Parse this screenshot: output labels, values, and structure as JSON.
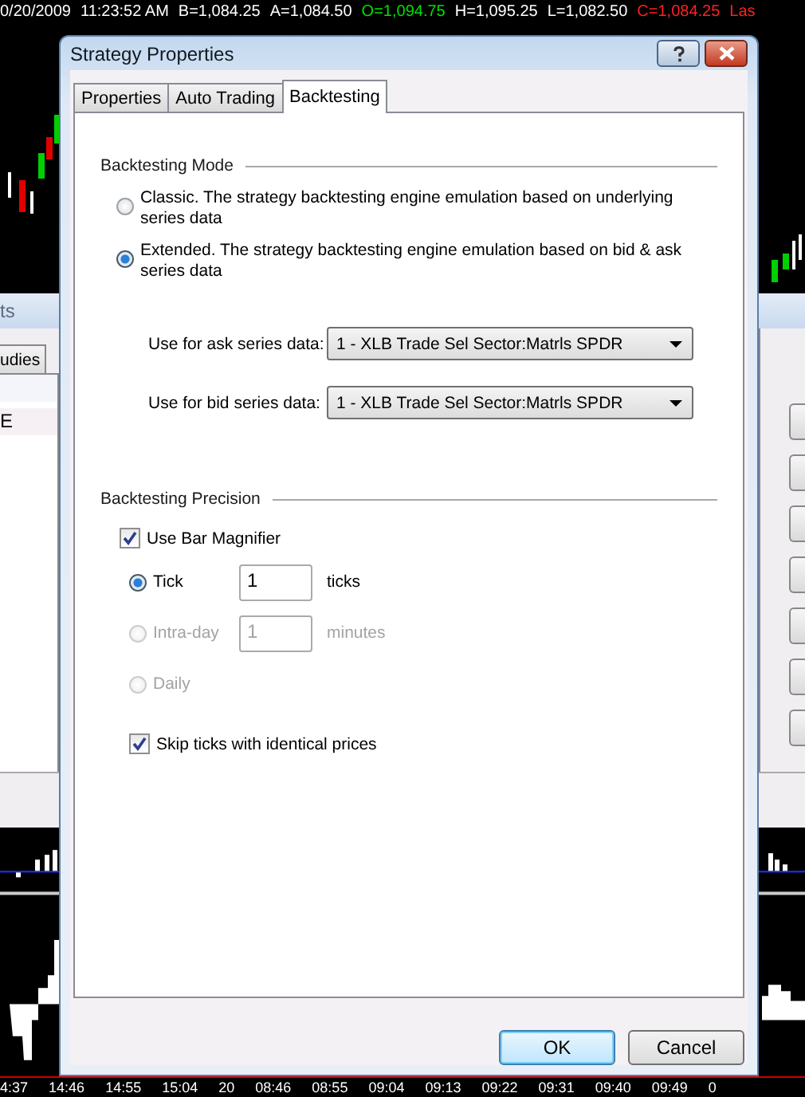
{
  "quote_bar": [
    {
      "text": "0/20/2009",
      "color": "#ffffff"
    },
    {
      "text": "11:23:52 AM",
      "color": "#ffffff"
    },
    {
      "text": "B=1,084.25",
      "color": "#ffffff"
    },
    {
      "text": "A=1,084.50",
      "color": "#ffffff"
    },
    {
      "text": "O=1,094.75",
      "color": "#00e000"
    },
    {
      "text": "H=1,095.25",
      "color": "#ffffff"
    },
    {
      "text": "L=1,082.50",
      "color": "#ffffff"
    },
    {
      "text": "C=1,084.25",
      "color": "#ff2020"
    },
    {
      "text": "Las",
      "color": "#ff2020"
    }
  ],
  "left_panel": {
    "title": "ts",
    "tab": "udies",
    "row": "E"
  },
  "dialog": {
    "title": "Strategy Properties",
    "tabs": [
      {
        "label": "Properties",
        "selected": false
      },
      {
        "label": "Auto Trading",
        "selected": false
      },
      {
        "label": "Backtesting",
        "selected": true
      }
    ],
    "mode_group": {
      "label": "Backtesting Mode",
      "options": [
        {
          "label": "Classic. The strategy backtesting engine emulation based on underlying series data",
          "selected": false
        },
        {
          "label": "Extended. The strategy backtesting engine emulation based on bid & ask series data",
          "selected": true
        }
      ]
    },
    "series": [
      {
        "label": "Use for ask series data:",
        "value": "1 - XLB Trade Sel Sector:Matrls SPDR"
      },
      {
        "label": "Use for bid series data:",
        "value": "1 - XLB Trade Sel Sector:Matrls SPDR"
      }
    ],
    "precision_group": {
      "label": "Backtesting Precision",
      "use_bar_magnifier": {
        "label": "Use Bar Magnifier",
        "checked": true
      },
      "options": [
        {
          "label": "Tick",
          "selected": true,
          "disabled": false,
          "value": "1",
          "unit": "ticks"
        },
        {
          "label": "Intra-day",
          "selected": false,
          "disabled": true,
          "value": "1",
          "unit": "minutes"
        },
        {
          "label": "Daily",
          "selected": false,
          "disabled": true
        }
      ],
      "skip_identical": {
        "label": "Skip ticks with identical prices",
        "checked": true
      }
    },
    "buttons": [
      {
        "label": "OK",
        "default": true
      },
      {
        "label": "Cancel",
        "default": false
      }
    ]
  },
  "time_axis": [
    "4:37",
    "14:46",
    "14:55",
    "15:04",
    "20",
    "08:46",
    "08:55",
    "09:04",
    "09:13",
    "09:22",
    "09:31",
    "09:40",
    "09:49",
    "0"
  ]
}
